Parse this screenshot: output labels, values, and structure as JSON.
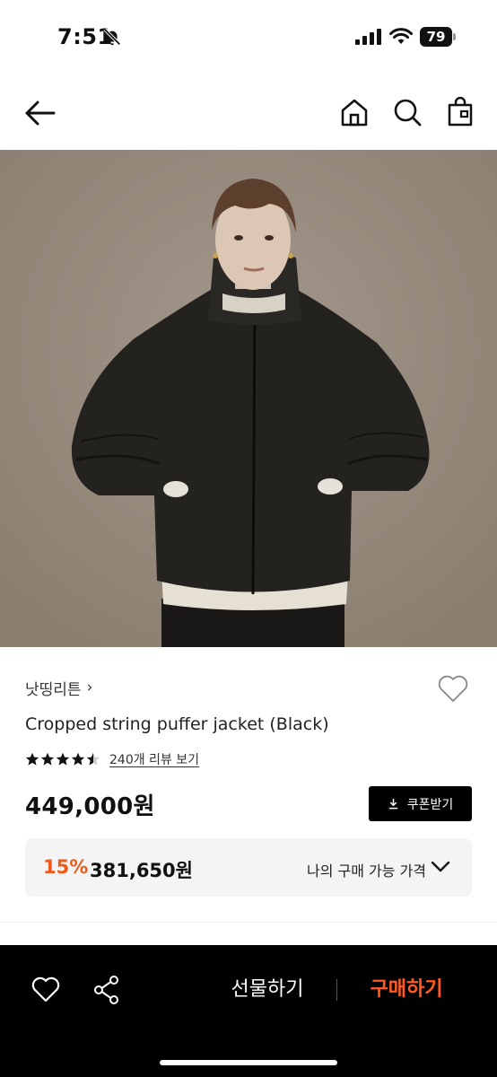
{
  "status_bar": {
    "time": "7:51",
    "battery": "79"
  },
  "product": {
    "brand": "낫띵리튼",
    "brand_chevron": "›",
    "title": "Cropped string puffer jacket (Black)",
    "rating": 4.5,
    "review_link": "240개 리뷰 보기",
    "price": "449,000원",
    "coupon_label": "쿠폰받기"
  },
  "discount": {
    "rate": "15%",
    "price": "381,650원",
    "label": "나의 구매 가능 가격"
  },
  "bottom_bar": {
    "gift_label": "선물하기",
    "buy_label": "구매하기"
  },
  "colors": {
    "accent": "#ec5a1d",
    "buy": "#ff5a1f",
    "coupon_bg": "#000000",
    "bottom_bar_bg": "#000000"
  },
  "icons": {
    "nav": [
      "back-arrow-icon",
      "home-icon",
      "search-icon",
      "bag-icon"
    ],
    "bottom": [
      "heart-icon",
      "share-icon"
    ]
  }
}
